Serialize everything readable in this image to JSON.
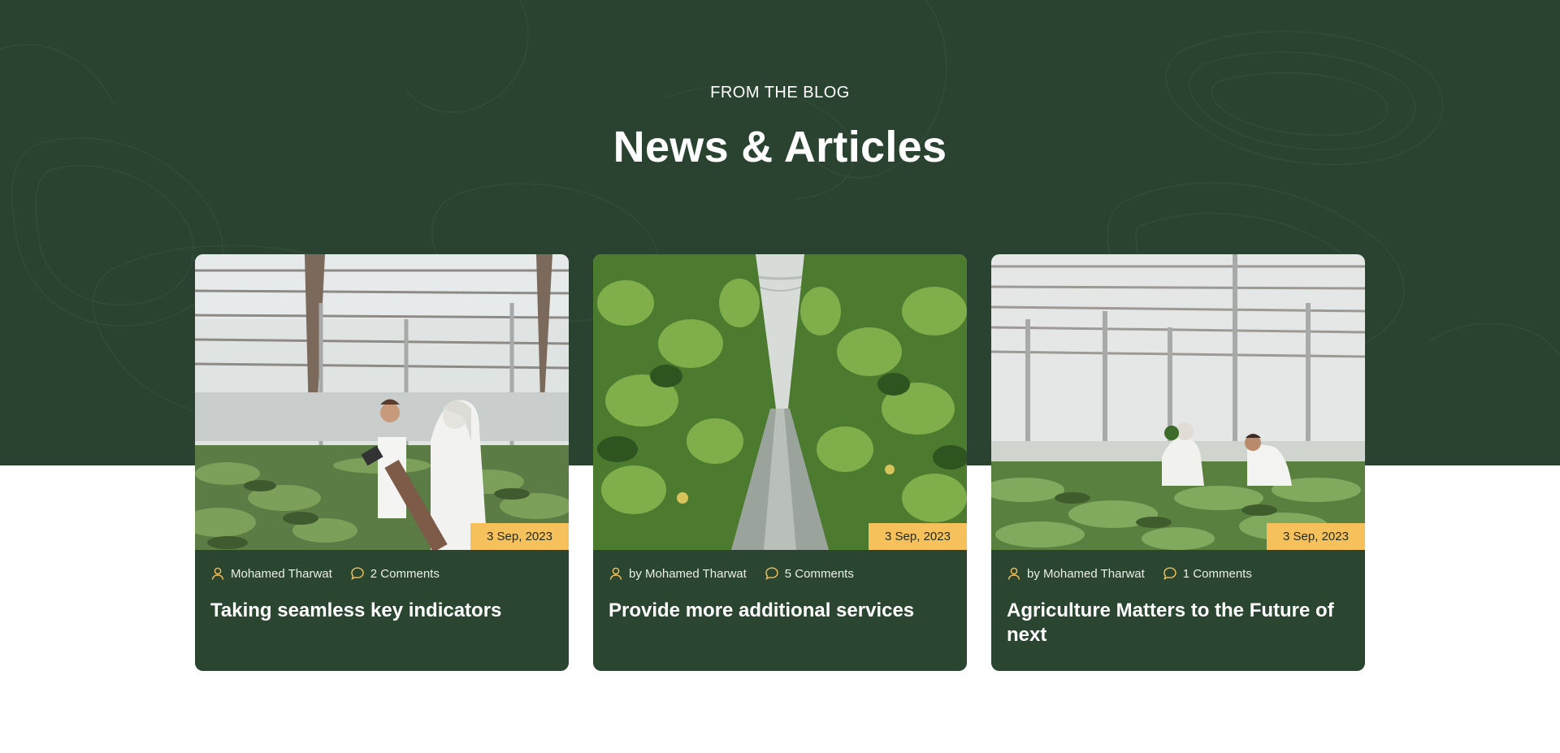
{
  "section": {
    "eyebrow": "FROM THE BLOG",
    "title": "News & Articles"
  },
  "colors": {
    "hero_bg": "#2a4330",
    "card_bg": "#2b4630",
    "accent": "#f6c15b",
    "text_light": "#ffffff"
  },
  "articles": [
    {
      "date": "3 Sep, 2023",
      "author": "Mohamed Tharwat",
      "comments": "2 Comments",
      "title": "Taking seamless key indicators",
      "author_icon": "user-icon",
      "comment_icon": "comment-icon",
      "image": "greenhouse-scientists-photo"
    },
    {
      "date": "3 Sep, 2023",
      "author": "by Mohamed Tharwat",
      "comments": "5 Comments",
      "title": "Provide more additional services",
      "author_icon": "user-icon",
      "comment_icon": "comment-icon",
      "image": "greenhouse-aisle-photo"
    },
    {
      "date": "3 Sep, 2023",
      "author": "by Mohamed Tharwat",
      "comments": "1 Comments",
      "title": "Agriculture Matters to the Future of next",
      "author_icon": "user-icon",
      "comment_icon": "comment-icon",
      "image": "greenhouse-workers-photo"
    }
  ]
}
